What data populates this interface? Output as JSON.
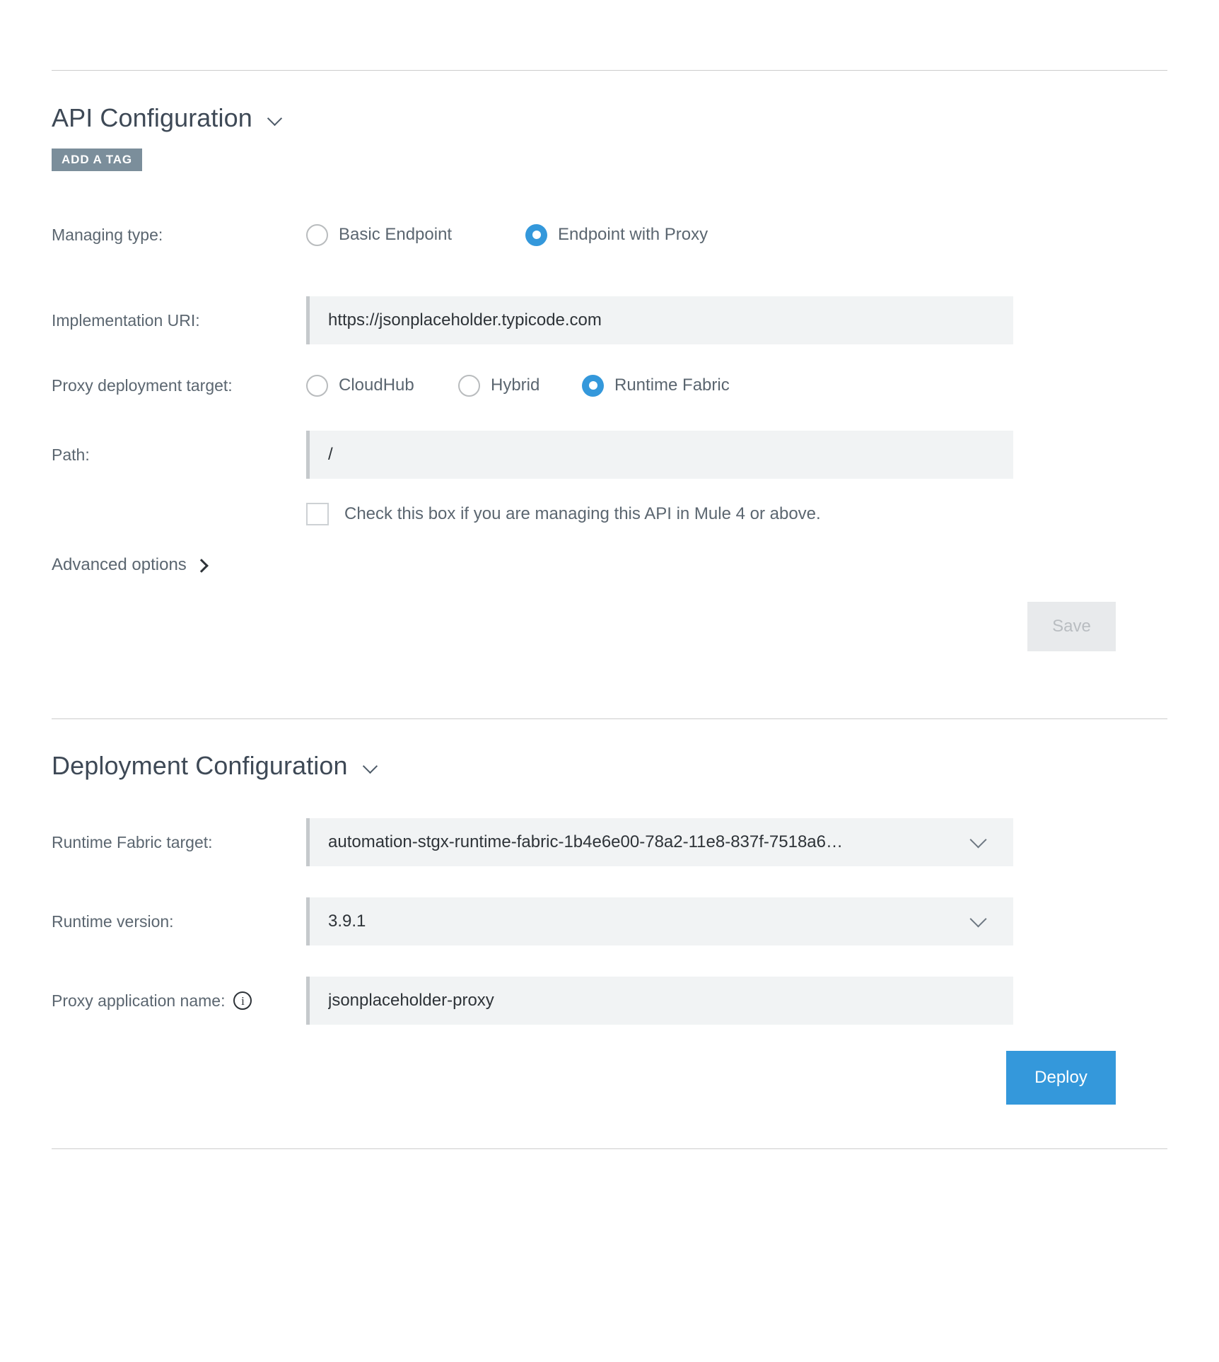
{
  "api_configuration": {
    "title": "API Configuration",
    "collapse_icon": "chevron-down-icon",
    "add_tag_label": "ADD A TAG",
    "managing_type": {
      "label": "Managing type:",
      "options": [
        {
          "label": "Basic Endpoint",
          "selected": false
        },
        {
          "label": "Endpoint with Proxy",
          "selected": true
        }
      ]
    },
    "implementation_uri": {
      "label": "Implementation URI:",
      "value": "https://jsonplaceholder.typicode.com",
      "placeholder": ""
    },
    "proxy_deployment_target": {
      "label": "Proxy deployment target:",
      "options": [
        {
          "label": "CloudHub",
          "selected": false
        },
        {
          "label": "Hybrid",
          "selected": false
        },
        {
          "label": "Runtime Fabric",
          "selected": true
        }
      ]
    },
    "path": {
      "label": "Path:",
      "value": "/",
      "placeholder": ""
    },
    "mule4_checkbox": {
      "label": "Check this box if you are managing this API in Mule 4 or above.",
      "checked": false
    },
    "advanced_options": {
      "label": "Advanced options",
      "expand_icon": "chevron-right-icon"
    },
    "save_button": {
      "label": "Save",
      "disabled": true
    }
  },
  "deployment_configuration": {
    "title": "Deployment Configuration",
    "collapse_icon": "chevron-down-icon",
    "runtime_fabric_target": {
      "label": "Runtime Fabric target:",
      "value": "automation-stgx-runtime-fabric-1b4e6e00-78a2-11e8-837f-7518a6…"
    },
    "runtime_version": {
      "label": "Runtime version:",
      "value": "3.9.1"
    },
    "proxy_application_name": {
      "label": "Proxy application name:",
      "info_icon": "info-icon",
      "value": "jsonplaceholder-proxy",
      "placeholder": ""
    },
    "deploy_button": {
      "label": "Deploy"
    }
  },
  "colors": {
    "accent_blue": "#3498db",
    "tag_gray": "#7b8e9b",
    "input_bg": "#f1f3f4",
    "input_border": "#c5c9cc",
    "divider": "#cdcdcd",
    "label_text": "#5b6670",
    "heading_text": "#3e4956"
  }
}
